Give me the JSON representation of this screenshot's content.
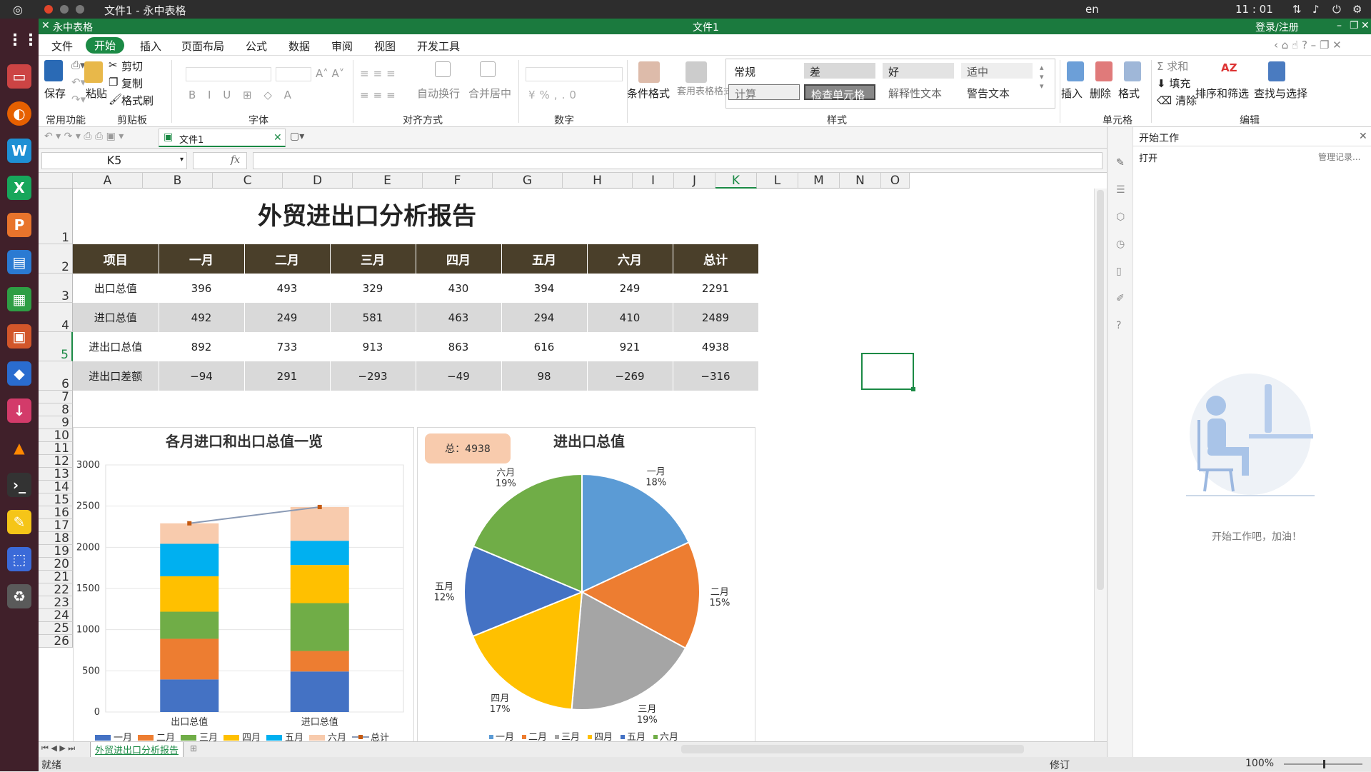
{
  "os_bar": {
    "title": "文件1 - 永中表格",
    "lang": "en",
    "clock": "11 : 01"
  },
  "app": {
    "name": "永中表格",
    "doc_title": "文件1",
    "login": "登录/注册"
  },
  "menu": [
    "文件",
    "开始",
    "插入",
    "页面布局",
    "公式",
    "数据",
    "审阅",
    "视图",
    "开发工具"
  ],
  "ribbon": {
    "save": "保存",
    "paste": "粘贴",
    "cut": "剪切",
    "copy": "复制",
    "format_painter": "格式刷",
    "groups": [
      "常用功能",
      "剪贴板",
      "字体",
      "对齐方式",
      "数字",
      "样式",
      "单元格",
      "编辑"
    ],
    "wrap": "自动换行",
    "merge": "合并居中",
    "cond_format": "条件格式",
    "table_format": "套用表格格式",
    "styles": [
      "常规",
      "差",
      "好",
      "适中",
      "计算",
      "检查单元格",
      "解释性文本",
      "警告文本"
    ],
    "insert": "插入",
    "delete": "删除",
    "format": "格式",
    "sum": "求和",
    "fill": "填充",
    "clear": "清除",
    "sort": "排序和筛选",
    "find": "查找与选择"
  },
  "doc_tab": "文件1",
  "name_box": "K5",
  "fx": "fx",
  "columns": [
    "A",
    "B",
    "C",
    "D",
    "E",
    "F",
    "G",
    "H",
    "I",
    "J",
    "K",
    "L",
    "M",
    "N",
    "O"
  ],
  "rows": [
    "1",
    "2",
    "3",
    "4",
    "5",
    "6",
    "7",
    "8",
    "9",
    "10",
    "11",
    "12",
    "13",
    "14",
    "15",
    "16",
    "17",
    "18",
    "19",
    "20",
    "21",
    "22",
    "23",
    "24",
    "25",
    "26"
  ],
  "sheet_title": "外贸进出口分析报告",
  "table": {
    "headers": [
      "项目",
      "一月",
      "二月",
      "三月",
      "四月",
      "五月",
      "六月",
      "总计"
    ],
    "rows": [
      [
        "出口总值",
        "396",
        "493",
        "329",
        "430",
        "394",
        "249",
        "2291"
      ],
      [
        "进口总值",
        "492",
        "249",
        "581",
        "463",
        "294",
        "410",
        "2489"
      ],
      [
        "进出口总值",
        "892",
        "733",
        "913",
        "863",
        "616",
        "921",
        "4938"
      ],
      [
        "进出口差额",
        "−94",
        "291",
        "−293",
        "−49",
        "98",
        "−269",
        "−316"
      ]
    ]
  },
  "chart_data": [
    {
      "type": "bar",
      "stacked": true,
      "title": "各月进口和出口总值一览",
      "categories": [
        "出口总值",
        "进口总值"
      ],
      "ylim": [
        0,
        3000
      ],
      "yticks": [
        "0",
        "500",
        "1000",
        "1500",
        "2000",
        "2500",
        "3000"
      ],
      "series": [
        {
          "name": "一月",
          "values": [
            396,
            492
          ],
          "color": "#4472c4"
        },
        {
          "name": "二月",
          "values": [
            493,
            249
          ],
          "color": "#ed7d31"
        },
        {
          "name": "三月",
          "values": [
            329,
            581
          ],
          "color": "#70ad47"
        },
        {
          "name": "四月",
          "values": [
            430,
            463
          ],
          "color": "#ffc000"
        },
        {
          "name": "五月",
          "values": [
            394,
            294
          ],
          "color": "#00b0f0"
        },
        {
          "name": "六月",
          "values": [
            249,
            410
          ],
          "color": "#f8cbad"
        },
        {
          "name": "总计",
          "values": [
            2291,
            2489
          ],
          "color": "#8a9ab5",
          "line": true
        }
      ]
    },
    {
      "type": "pie",
      "title": "进出口总值",
      "badge": "总：4938",
      "labels": [
        "一月",
        "二月",
        "三月",
        "四月",
        "五月",
        "六月"
      ],
      "values": [
        892,
        733,
        913,
        863,
        616,
        921
      ],
      "percents": [
        "18%",
        "15%",
        "19%",
        "17%",
        "12%",
        "19%"
      ],
      "colors": [
        "#5b9bd5",
        "#ed7d31",
        "#a5a5a5",
        "#ffc000",
        "#4472c4",
        "#70ad47"
      ]
    }
  ],
  "panel": {
    "title": "开始工作",
    "open": "打开",
    "manage": "管理记录...",
    "cheer": "开始工作吧，加油！"
  },
  "sheet_tab": "外贸进出口分析报告",
  "status": {
    "ready": "就绪",
    "mode": "修订",
    "zoom": "100%"
  }
}
